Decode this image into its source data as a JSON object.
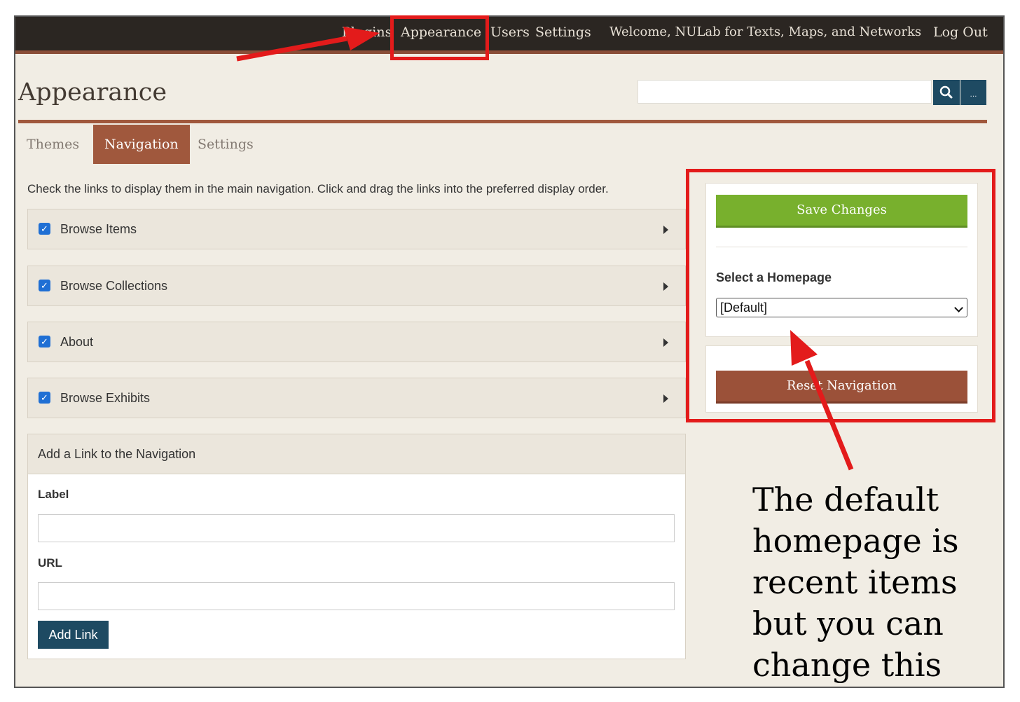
{
  "topbar": {
    "plugins_label": "Plugins",
    "appearance_label": "Appearance",
    "users_label": "Users",
    "settings_label": "Settings",
    "welcome_text": "Welcome, NULab for Texts, Maps, and Networks",
    "logout_label": "Log Out"
  },
  "page": {
    "title": "Appearance"
  },
  "search": {
    "more_label": "..."
  },
  "tabs": [
    {
      "label": "Themes",
      "active": false
    },
    {
      "label": "Navigation",
      "active": true
    },
    {
      "label": "Settings",
      "active": false
    }
  ],
  "instructions": "Check the links to display them in the main navigation. Click and drag the links into the preferred display order.",
  "nav_items": [
    {
      "label": "Browse Items",
      "checked": true
    },
    {
      "label": "Browse Collections",
      "checked": true
    },
    {
      "label": "About",
      "checked": true
    },
    {
      "label": "Browse Exhibits",
      "checked": true
    }
  ],
  "add_link": {
    "heading": "Add a Link to the Navigation",
    "label_field": "Label",
    "url_field": "URL",
    "button": "Add Link"
  },
  "sidebar": {
    "save_button": "Save Changes",
    "homepage_label": "Select a Homepage",
    "homepage_value": "[Default]",
    "reset_button": "Reset Navigation"
  },
  "annotation": {
    "lines": [
      "The default",
      "homepage is",
      "recent items",
      "but you can",
      "change this"
    ],
    "color": "#e31b1b"
  }
}
